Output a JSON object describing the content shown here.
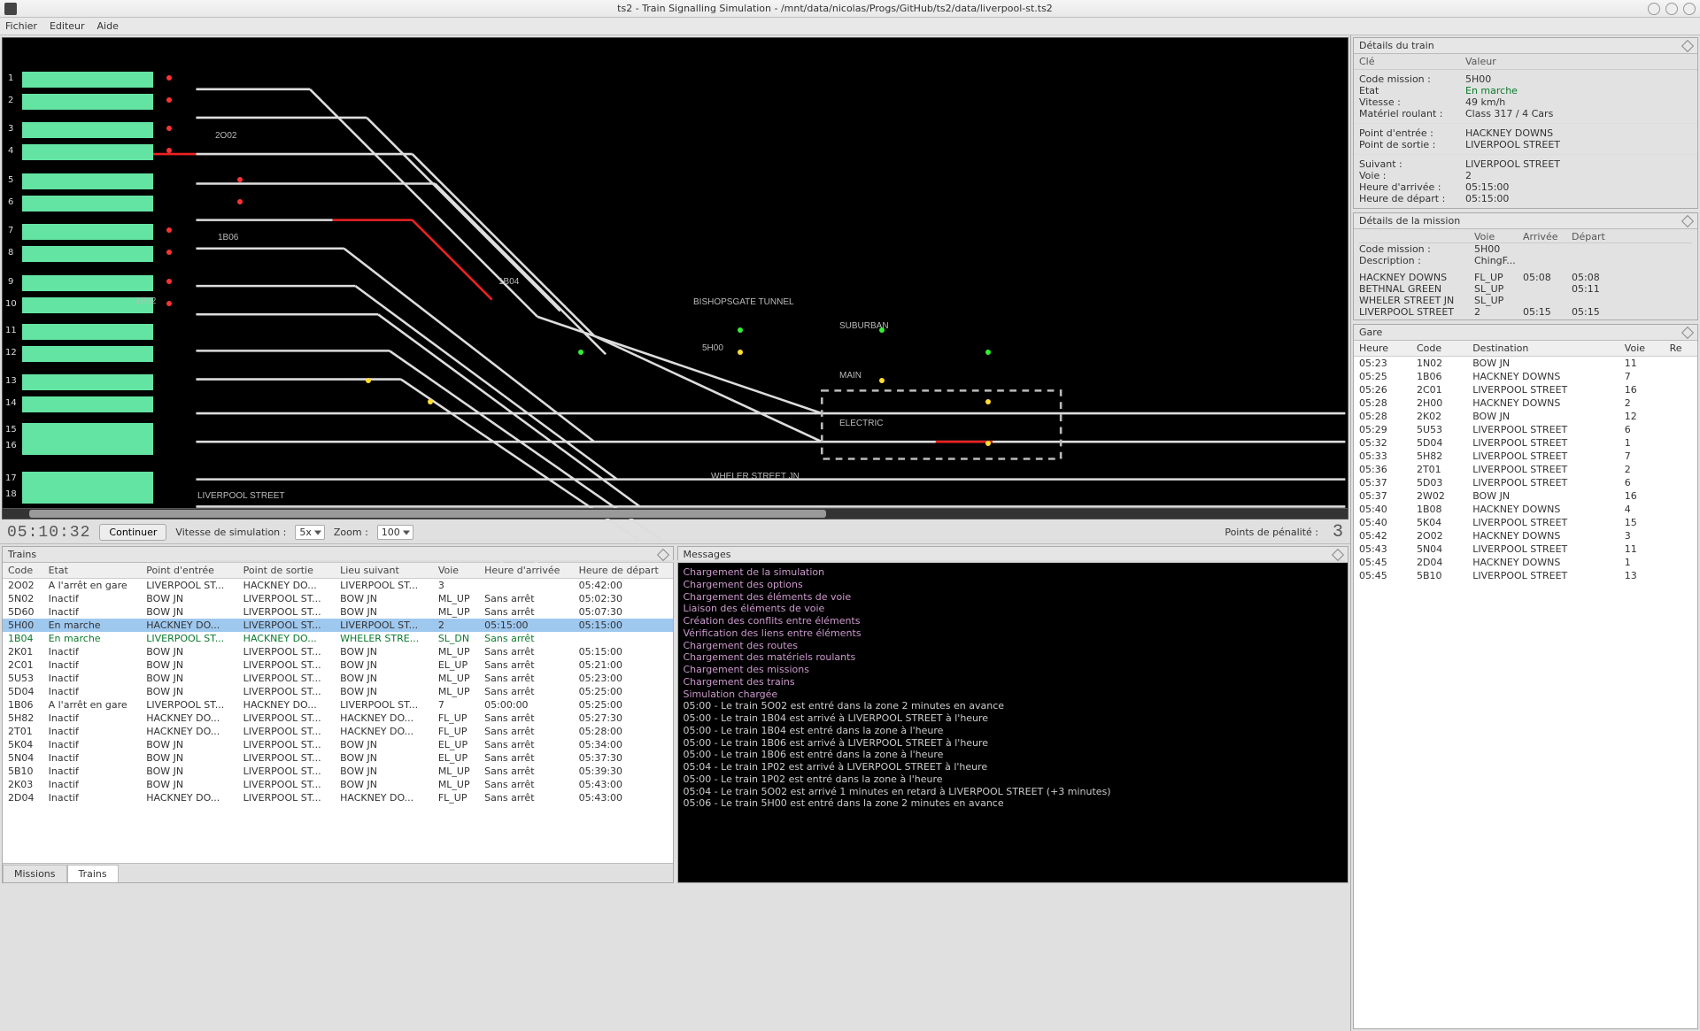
{
  "window": {
    "title": "ts2 - Train Signalling Simulation - /mnt/data/nicolas/Progs/GitHub/ts2/data/liverpool-st.ts2"
  },
  "menu": {
    "items": [
      "Fichier",
      "Editeur",
      "Aide"
    ]
  },
  "controls": {
    "clock": "05:10:32",
    "continue_btn": "Continuer",
    "speed_label": "Vitesse de simulation :",
    "speed_value": "5x",
    "zoom_label": "Zoom :",
    "zoom_value": "100",
    "penalty_label": "Points de pénalité :",
    "penalty_value": "3"
  },
  "track_labels": {
    "t2O02": "2O02",
    "t1B06": "1B06",
    "t1B04": "1B04",
    "t1P02": "1P02",
    "t5H00": "5H00",
    "bishopsgate": "BISHOPSGATE TUNNEL",
    "suburban": "SUBURBAN",
    "main": "MAIN",
    "electric": "ELECTRIC",
    "wheler": "WHELER STREET JN",
    "liverpool": "LIVERPOOL STREET"
  },
  "trains_panel": {
    "title": "Trains",
    "headers": [
      "Code",
      "Etat",
      "Point d'entrée",
      "Point de sortie",
      "Lieu suivant",
      "Voie",
      "Heure d'arrivée",
      "Heure de départ"
    ],
    "tabs": [
      "Missions",
      "Trains"
    ],
    "active_tab": 1,
    "selected_code": "5H00",
    "rows": [
      {
        "code": "2O02",
        "etat": "A l'arrêt en gare",
        "in": "LIVERPOOL ST...",
        "out": "HACKNEY DO...",
        "next": "LIVERPOOL ST...",
        "voie": "3",
        "arr": "",
        "dep": "05:42:00"
      },
      {
        "code": "5N02",
        "etat": "Inactif",
        "in": "BOW JN",
        "out": "LIVERPOOL ST...",
        "next": "BOW JN",
        "voie": "ML_UP",
        "arr": "Sans arrêt",
        "dep": "05:02:30"
      },
      {
        "code": "5D60",
        "etat": "Inactif",
        "in": "BOW JN",
        "out": "LIVERPOOL ST...",
        "next": "BOW JN",
        "voie": "ML_UP",
        "arr": "Sans arrêt",
        "dep": "05:07:30"
      },
      {
        "code": "5H00",
        "etat": "En marche",
        "in": "HACKNEY DO...",
        "out": "LIVERPOOL ST...",
        "next": "LIVERPOOL ST...",
        "voie": "2",
        "arr": "05:15:00",
        "dep": "05:15:00",
        "running": true
      },
      {
        "code": "1B04",
        "etat": "En marche",
        "in": "LIVERPOOL ST...",
        "out": "HACKNEY DO...",
        "next": "WHELER STRE...",
        "voie": "SL_DN",
        "arr": "Sans arrêt",
        "dep": "",
        "running": true
      },
      {
        "code": "2K01",
        "etat": "Inactif",
        "in": "BOW JN",
        "out": "LIVERPOOL ST...",
        "next": "BOW JN",
        "voie": "ML_UP",
        "arr": "Sans arrêt",
        "dep": "05:15:00"
      },
      {
        "code": "2C01",
        "etat": "Inactif",
        "in": "BOW JN",
        "out": "LIVERPOOL ST...",
        "next": "BOW JN",
        "voie": "EL_UP",
        "arr": "Sans arrêt",
        "dep": "05:21:00"
      },
      {
        "code": "5U53",
        "etat": "Inactif",
        "in": "BOW JN",
        "out": "LIVERPOOL ST...",
        "next": "BOW JN",
        "voie": "ML_UP",
        "arr": "Sans arrêt",
        "dep": "05:23:00"
      },
      {
        "code": "5D04",
        "etat": "Inactif",
        "in": "BOW JN",
        "out": "LIVERPOOL ST...",
        "next": "BOW JN",
        "voie": "ML_UP",
        "arr": "Sans arrêt",
        "dep": "05:25:00"
      },
      {
        "code": "1B06",
        "etat": "A l'arrêt en gare",
        "in": "LIVERPOOL ST...",
        "out": "HACKNEY DO...",
        "next": "LIVERPOOL ST...",
        "voie": "7",
        "arr": "05:00:00",
        "dep": "05:25:00"
      },
      {
        "code": "5H82",
        "etat": "Inactif",
        "in": "HACKNEY DO...",
        "out": "LIVERPOOL ST...",
        "next": "HACKNEY DO...",
        "voie": "FL_UP",
        "arr": "Sans arrêt",
        "dep": "05:27:30"
      },
      {
        "code": "2T01",
        "etat": "Inactif",
        "in": "HACKNEY DO...",
        "out": "LIVERPOOL ST...",
        "next": "HACKNEY DO...",
        "voie": "FL_UP",
        "arr": "Sans arrêt",
        "dep": "05:28:00"
      },
      {
        "code": "5K04",
        "etat": "Inactif",
        "in": "BOW JN",
        "out": "LIVERPOOL ST...",
        "next": "BOW JN",
        "voie": "EL_UP",
        "arr": "Sans arrêt",
        "dep": "05:34:00"
      },
      {
        "code": "5N04",
        "etat": "Inactif",
        "in": "BOW JN",
        "out": "LIVERPOOL ST...",
        "next": "BOW JN",
        "voie": "EL_UP",
        "arr": "Sans arrêt",
        "dep": "05:37:30"
      },
      {
        "code": "5B10",
        "etat": "Inactif",
        "in": "BOW JN",
        "out": "LIVERPOOL ST...",
        "next": "BOW JN",
        "voie": "ML_UP",
        "arr": "Sans arrêt",
        "dep": "05:39:30"
      },
      {
        "code": "2K03",
        "etat": "Inactif",
        "in": "BOW JN",
        "out": "LIVERPOOL ST...",
        "next": "BOW JN",
        "voie": "ML_UP",
        "arr": "Sans arrêt",
        "dep": "05:43:00"
      },
      {
        "code": "2D04",
        "etat": "Inactif",
        "in": "HACKNEY DO...",
        "out": "LIVERPOOL ST...",
        "next": "HACKNEY DO...",
        "voie": "FL_UP",
        "arr": "Sans arrêt",
        "dep": "05:43:00"
      }
    ]
  },
  "messages_panel": {
    "title": "Messages",
    "lines": [
      {
        "t": "Chargement de la simulation",
        "c": "m"
      },
      {
        "t": "Chargement des options",
        "c": "m"
      },
      {
        "t": "Chargement des éléments de voie",
        "c": "m"
      },
      {
        "t": "Liaison des éléments de voie",
        "c": "m"
      },
      {
        "t": "Création des conflits entre éléments",
        "c": "m"
      },
      {
        "t": "Vérification des liens entre éléments",
        "c": "m"
      },
      {
        "t": "Chargement des routes",
        "c": "m"
      },
      {
        "t": "Chargement des matériels roulants",
        "c": "m"
      },
      {
        "t": "Chargement des missions",
        "c": "m"
      },
      {
        "t": "Chargement des trains",
        "c": "m"
      },
      {
        "t": "Simulation chargée",
        "c": "m"
      },
      {
        "t": "05:00 - Le train 5O02 est entré dans la zone 2 minutes en avance",
        "c": "w"
      },
      {
        "t": "05:00 - Le train 1B04 est arrivé à LIVERPOOL STREET à l'heure",
        "c": "w"
      },
      {
        "t": "05:00 - Le train 1B04 est entré dans la zone à l'heure",
        "c": "w"
      },
      {
        "t": "05:00 - Le train 1B06 est arrivé à LIVERPOOL STREET à l'heure",
        "c": "w"
      },
      {
        "t": "05:00 - Le train 1B06 est entré dans la zone à l'heure",
        "c": "w"
      },
      {
        "t": "05:04 - Le train 1P02 est arrivé à LIVERPOOL STREET à l'heure",
        "c": "w"
      },
      {
        "t": "05:00 - Le train 1P02 est entré dans la zone à l'heure",
        "c": "w"
      },
      {
        "t": "05:04 - Le train 5O02 est arrivé 1 minutes en retard à LIVERPOOL STREET (+3 minutes)",
        "c": "w"
      },
      {
        "t": "05:06 - Le train 5H00 est entré dans la zone 2 minutes en avance",
        "c": "w"
      }
    ]
  },
  "train_details": {
    "title": "Détails du train",
    "hdr_key": "Clé",
    "hdr_val": "Valeur",
    "rows1": [
      {
        "k": "Code mission :",
        "v": "5H00"
      },
      {
        "k": "Etat",
        "v": "En marche",
        "green": true
      },
      {
        "k": "Vitesse :",
        "v": "49 km/h"
      },
      {
        "k": "Matériel roulant :",
        "v": "Class 317 / 4 Cars"
      }
    ],
    "rows2": [
      {
        "k": "Point d'entrée :",
        "v": "HACKNEY DOWNS"
      },
      {
        "k": "Point de sortie :",
        "v": "LIVERPOOL STREET"
      }
    ],
    "rows3": [
      {
        "k": "Suivant :",
        "v": "LIVERPOOL STREET"
      },
      {
        "k": "Voie :",
        "v": "2"
      },
      {
        "k": "Heure d'arrivée :",
        "v": "05:15:00"
      },
      {
        "k": "Heure de départ :",
        "v": "05:15:00"
      }
    ]
  },
  "mission_details": {
    "title": "Détails de la mission",
    "hdr": {
      "voie": "Voie",
      "arr": "Arrivée",
      "dep": "Départ"
    },
    "info": [
      {
        "k": "Code mission :",
        "v": "5H00"
      },
      {
        "k": "Description :",
        "v": "ChingF..."
      }
    ],
    "stops": [
      {
        "n": "HACKNEY DOWNS",
        "v": "FL_UP",
        "a": "05:08",
        "d": "05:08"
      },
      {
        "n": "BETHNAL GREEN",
        "v": "SL_UP",
        "a": "",
        "d": "05:11"
      },
      {
        "n": "WHELER STREET JN",
        "v": "SL_UP",
        "a": "",
        "d": ""
      },
      {
        "n": "LIVERPOOL STREET",
        "v": "2",
        "a": "05:15",
        "d": "05:15"
      }
    ]
  },
  "station_panel": {
    "title": "Gare",
    "headers": [
      "Heure",
      "Code",
      "Destination",
      "Voie",
      "Re"
    ],
    "rows": [
      {
        "h": "05:23",
        "c": "1N02",
        "d": "BOW JN",
        "v": "11"
      },
      {
        "h": "05:25",
        "c": "1B06",
        "d": "HACKNEY DOWNS",
        "v": "7"
      },
      {
        "h": "05:26",
        "c": "2C01",
        "d": "LIVERPOOL STREET",
        "v": "16"
      },
      {
        "h": "05:28",
        "c": "2H00",
        "d": "HACKNEY DOWNS",
        "v": "2"
      },
      {
        "h": "05:28",
        "c": "2K02",
        "d": "BOW JN",
        "v": "12"
      },
      {
        "h": "05:29",
        "c": "5U53",
        "d": "LIVERPOOL STREET",
        "v": "6"
      },
      {
        "h": "05:32",
        "c": "5D04",
        "d": "LIVERPOOL STREET",
        "v": "1"
      },
      {
        "h": "05:33",
        "c": "5H82",
        "d": "LIVERPOOL STREET",
        "v": "7"
      },
      {
        "h": "05:36",
        "c": "2T01",
        "d": "LIVERPOOL STREET",
        "v": "2"
      },
      {
        "h": "05:37",
        "c": "5D03",
        "d": "LIVERPOOL STREET",
        "v": "6"
      },
      {
        "h": "05:37",
        "c": "2W02",
        "d": "BOW JN",
        "v": "16"
      },
      {
        "h": "05:40",
        "c": "1B08",
        "d": "HACKNEY DOWNS",
        "v": "4"
      },
      {
        "h": "05:40",
        "c": "5K04",
        "d": "LIVERPOOL STREET",
        "v": "15"
      },
      {
        "h": "05:42",
        "c": "2O02",
        "d": "HACKNEY DOWNS",
        "v": "3"
      },
      {
        "h": "05:43",
        "c": "5N04",
        "d": "LIVERPOOL STREET",
        "v": "11"
      },
      {
        "h": "05:45",
        "c": "2D04",
        "d": "HACKNEY DOWNS",
        "v": "1"
      },
      {
        "h": "05:45",
        "c": "5B10",
        "d": "LIVERPOOL STREET",
        "v": "13"
      }
    ]
  }
}
